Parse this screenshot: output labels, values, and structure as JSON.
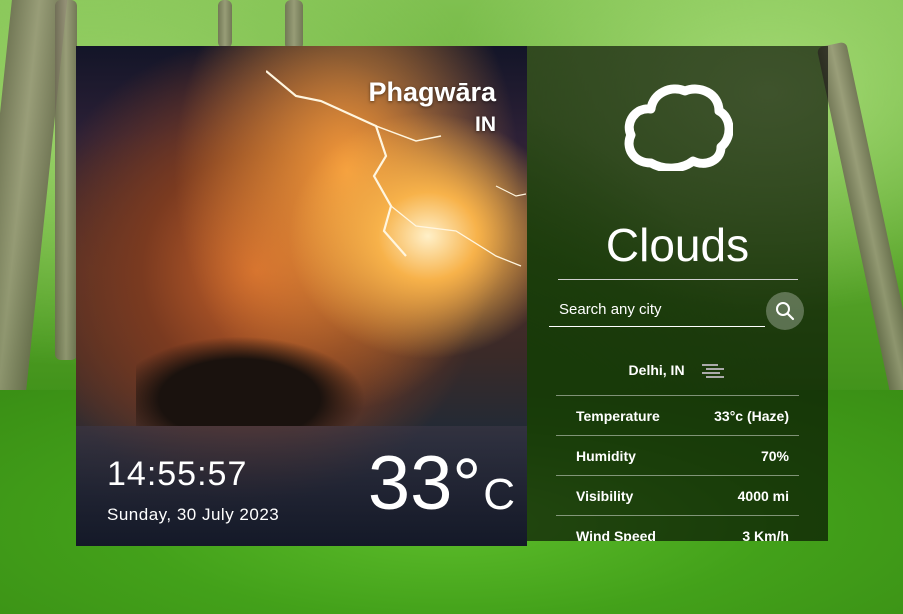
{
  "location": {
    "city": "Phagwāra",
    "country": "IN"
  },
  "clock": {
    "time": "14:55:57",
    "date": "Sunday, 30 July 2023"
  },
  "current": {
    "temp_value": "33",
    "temp_degree": "°",
    "temp_unit": "C"
  },
  "weather": {
    "condition": "Clouds",
    "icon": "cloud-icon"
  },
  "search": {
    "placeholder": "Search any city",
    "button_icon": "search-icon"
  },
  "details": {
    "location": "Delhi, IN",
    "location_icon": "haze-icon",
    "rows": [
      {
        "label": "Temperature",
        "value": "33°c (Haze)"
      },
      {
        "label": "Humidity",
        "value": "70%"
      },
      {
        "label": "Visibility",
        "value": "4000 mi"
      },
      {
        "label": "Wind Speed",
        "value": "3 Km/h"
      }
    ]
  }
}
